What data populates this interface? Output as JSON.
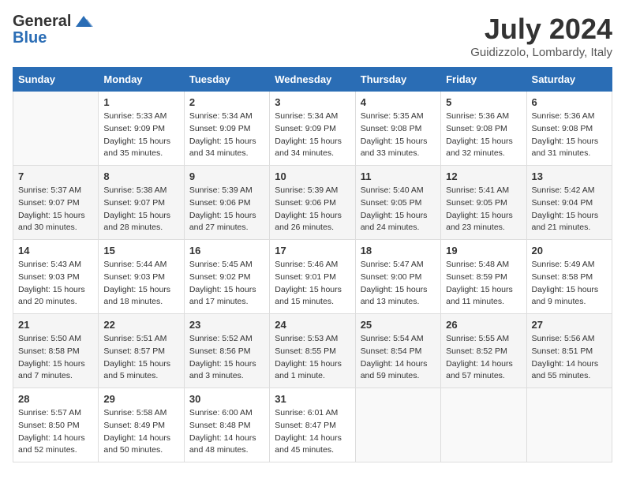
{
  "header": {
    "logo_general": "General",
    "logo_blue": "Blue",
    "month_title": "July 2024",
    "location": "Guidizzolo, Lombardy, Italy"
  },
  "days_of_week": [
    "Sunday",
    "Monday",
    "Tuesday",
    "Wednesday",
    "Thursday",
    "Friday",
    "Saturday"
  ],
  "weeks": [
    [
      {
        "day": "",
        "sunrise": "",
        "sunset": "",
        "daylight": ""
      },
      {
        "day": "1",
        "sunrise": "Sunrise: 5:33 AM",
        "sunset": "Sunset: 9:09 PM",
        "daylight": "Daylight: 15 hours and 35 minutes."
      },
      {
        "day": "2",
        "sunrise": "Sunrise: 5:34 AM",
        "sunset": "Sunset: 9:09 PM",
        "daylight": "Daylight: 15 hours and 34 minutes."
      },
      {
        "day": "3",
        "sunrise": "Sunrise: 5:34 AM",
        "sunset": "Sunset: 9:09 PM",
        "daylight": "Daylight: 15 hours and 34 minutes."
      },
      {
        "day": "4",
        "sunrise": "Sunrise: 5:35 AM",
        "sunset": "Sunset: 9:08 PM",
        "daylight": "Daylight: 15 hours and 33 minutes."
      },
      {
        "day": "5",
        "sunrise": "Sunrise: 5:36 AM",
        "sunset": "Sunset: 9:08 PM",
        "daylight": "Daylight: 15 hours and 32 minutes."
      },
      {
        "day": "6",
        "sunrise": "Sunrise: 5:36 AM",
        "sunset": "Sunset: 9:08 PM",
        "daylight": "Daylight: 15 hours and 31 minutes."
      }
    ],
    [
      {
        "day": "7",
        "sunrise": "Sunrise: 5:37 AM",
        "sunset": "Sunset: 9:07 PM",
        "daylight": "Daylight: 15 hours and 30 minutes."
      },
      {
        "day": "8",
        "sunrise": "Sunrise: 5:38 AM",
        "sunset": "Sunset: 9:07 PM",
        "daylight": "Daylight: 15 hours and 28 minutes."
      },
      {
        "day": "9",
        "sunrise": "Sunrise: 5:39 AM",
        "sunset": "Sunset: 9:06 PM",
        "daylight": "Daylight: 15 hours and 27 minutes."
      },
      {
        "day": "10",
        "sunrise": "Sunrise: 5:39 AM",
        "sunset": "Sunset: 9:06 PM",
        "daylight": "Daylight: 15 hours and 26 minutes."
      },
      {
        "day": "11",
        "sunrise": "Sunrise: 5:40 AM",
        "sunset": "Sunset: 9:05 PM",
        "daylight": "Daylight: 15 hours and 24 minutes."
      },
      {
        "day": "12",
        "sunrise": "Sunrise: 5:41 AM",
        "sunset": "Sunset: 9:05 PM",
        "daylight": "Daylight: 15 hours and 23 minutes."
      },
      {
        "day": "13",
        "sunrise": "Sunrise: 5:42 AM",
        "sunset": "Sunset: 9:04 PM",
        "daylight": "Daylight: 15 hours and 21 minutes."
      }
    ],
    [
      {
        "day": "14",
        "sunrise": "Sunrise: 5:43 AM",
        "sunset": "Sunset: 9:03 PM",
        "daylight": "Daylight: 15 hours and 20 minutes."
      },
      {
        "day": "15",
        "sunrise": "Sunrise: 5:44 AM",
        "sunset": "Sunset: 9:03 PM",
        "daylight": "Daylight: 15 hours and 18 minutes."
      },
      {
        "day": "16",
        "sunrise": "Sunrise: 5:45 AM",
        "sunset": "Sunset: 9:02 PM",
        "daylight": "Daylight: 15 hours and 17 minutes."
      },
      {
        "day": "17",
        "sunrise": "Sunrise: 5:46 AM",
        "sunset": "Sunset: 9:01 PM",
        "daylight": "Daylight: 15 hours and 15 minutes."
      },
      {
        "day": "18",
        "sunrise": "Sunrise: 5:47 AM",
        "sunset": "Sunset: 9:00 PM",
        "daylight": "Daylight: 15 hours and 13 minutes."
      },
      {
        "day": "19",
        "sunrise": "Sunrise: 5:48 AM",
        "sunset": "Sunset: 8:59 PM",
        "daylight": "Daylight: 15 hours and 11 minutes."
      },
      {
        "day": "20",
        "sunrise": "Sunrise: 5:49 AM",
        "sunset": "Sunset: 8:58 PM",
        "daylight": "Daylight: 15 hours and 9 minutes."
      }
    ],
    [
      {
        "day": "21",
        "sunrise": "Sunrise: 5:50 AM",
        "sunset": "Sunset: 8:58 PM",
        "daylight": "Daylight: 15 hours and 7 minutes."
      },
      {
        "day": "22",
        "sunrise": "Sunrise: 5:51 AM",
        "sunset": "Sunset: 8:57 PM",
        "daylight": "Daylight: 15 hours and 5 minutes."
      },
      {
        "day": "23",
        "sunrise": "Sunrise: 5:52 AM",
        "sunset": "Sunset: 8:56 PM",
        "daylight": "Daylight: 15 hours and 3 minutes."
      },
      {
        "day": "24",
        "sunrise": "Sunrise: 5:53 AM",
        "sunset": "Sunset: 8:55 PM",
        "daylight": "Daylight: 15 hours and 1 minute."
      },
      {
        "day": "25",
        "sunrise": "Sunrise: 5:54 AM",
        "sunset": "Sunset: 8:54 PM",
        "daylight": "Daylight: 14 hours and 59 minutes."
      },
      {
        "day": "26",
        "sunrise": "Sunrise: 5:55 AM",
        "sunset": "Sunset: 8:52 PM",
        "daylight": "Daylight: 14 hours and 57 minutes."
      },
      {
        "day": "27",
        "sunrise": "Sunrise: 5:56 AM",
        "sunset": "Sunset: 8:51 PM",
        "daylight": "Daylight: 14 hours and 55 minutes."
      }
    ],
    [
      {
        "day": "28",
        "sunrise": "Sunrise: 5:57 AM",
        "sunset": "Sunset: 8:50 PM",
        "daylight": "Daylight: 14 hours and 52 minutes."
      },
      {
        "day": "29",
        "sunrise": "Sunrise: 5:58 AM",
        "sunset": "Sunset: 8:49 PM",
        "daylight": "Daylight: 14 hours and 50 minutes."
      },
      {
        "day": "30",
        "sunrise": "Sunrise: 6:00 AM",
        "sunset": "Sunset: 8:48 PM",
        "daylight": "Daylight: 14 hours and 48 minutes."
      },
      {
        "day": "31",
        "sunrise": "Sunrise: 6:01 AM",
        "sunset": "Sunset: 8:47 PM",
        "daylight": "Daylight: 14 hours and 45 minutes."
      },
      {
        "day": "",
        "sunrise": "",
        "sunset": "",
        "daylight": ""
      },
      {
        "day": "",
        "sunrise": "",
        "sunset": "",
        "daylight": ""
      },
      {
        "day": "",
        "sunrise": "",
        "sunset": "",
        "daylight": ""
      }
    ]
  ]
}
